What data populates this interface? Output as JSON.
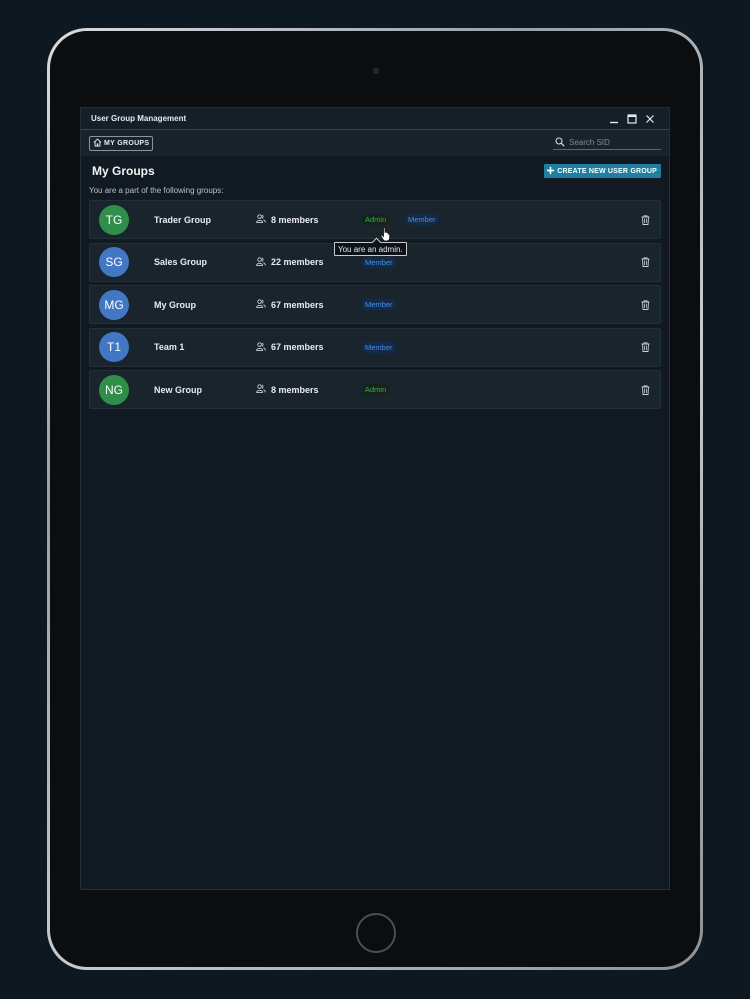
{
  "window": {
    "title": "User Group Management"
  },
  "toolbar": {
    "tab_label": "MY GROUPS",
    "search_placeholder": "Search SID"
  },
  "main": {
    "title": "My Groups",
    "create_button_label": "CREATE NEW USER GROUP",
    "subtitle": "You are a part of the following groups:",
    "tooltip": "You are an admin."
  },
  "groups": [
    {
      "initials": "TG",
      "name": "Trader Group",
      "members": "8 members",
      "avatar_color": "#2f8f4a",
      "badges": [
        "Admin",
        "Member"
      ]
    },
    {
      "initials": "SG",
      "name": "Sales Group",
      "members": "22 members",
      "avatar_color": "#4277c4",
      "badges": [
        "Member"
      ]
    },
    {
      "initials": "MG",
      "name": "My Group",
      "members": "67 members",
      "avatar_color": "#4277c4",
      "badges": [
        "Member"
      ]
    },
    {
      "initials": "T1",
      "name": "Team 1",
      "members": "67 members",
      "avatar_color": "#4277c4",
      "badges": [
        "Member"
      ]
    },
    {
      "initials": "NG",
      "name": "New Group",
      "members": "8 members",
      "avatar_color": "#2f8f4a",
      "badges": [
        "Admin"
      ]
    }
  ],
  "colors": {
    "accent": "#1f7fa0",
    "admin_text": "#35b04a",
    "member_text": "#4c8fe0"
  },
  "icons": {
    "home": "home-icon",
    "search": "search-icon",
    "plus": "plus-icon",
    "members": "people-icon",
    "delete": "trash-icon",
    "minimize": "minimize-icon",
    "maximize": "maximize-icon",
    "close": "close-icon"
  }
}
